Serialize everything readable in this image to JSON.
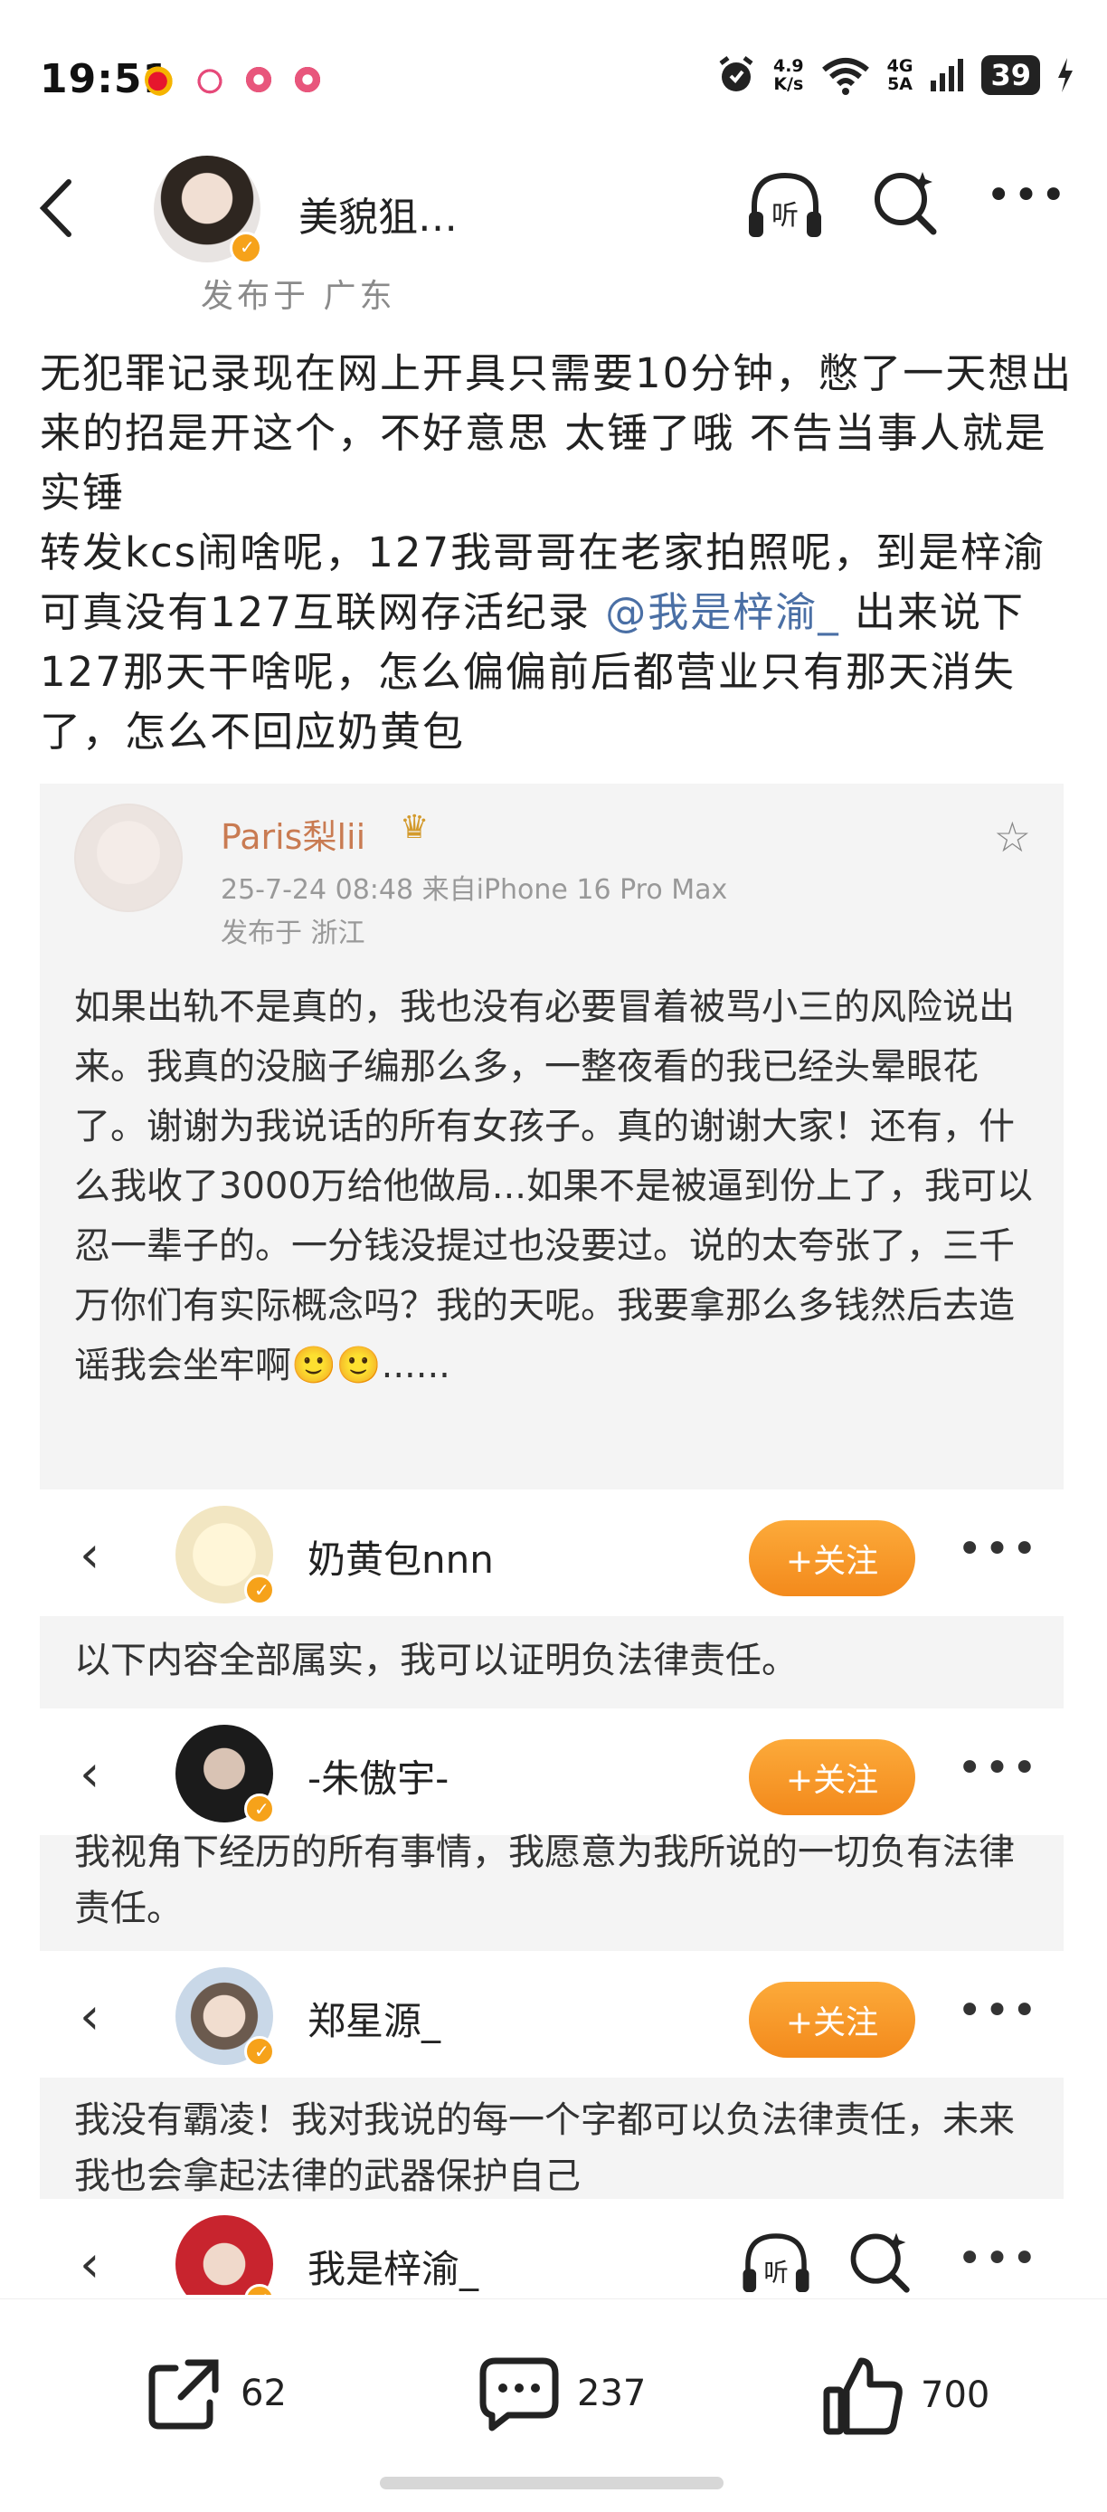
{
  "status_bar": {
    "time": "19:51",
    "net_speed_value": "4.9",
    "net_speed_unit": "K/s",
    "signal_top": "4G",
    "signal_bottom": "5A",
    "battery": "39"
  },
  "header": {
    "username": "美貌狙…",
    "published_location": "发布于 广东"
  },
  "post": {
    "para1": "无犯罪记录现在网上开具只需要10分钟，憋了一天想出来的招是开这个，不好意思 太锤了哦 不告当事人就是实锤",
    "para2_before": "转发kcs闹啥呢，127我哥哥在老家拍照呢，到是梓渝可真没有127互联网存活纪录 ",
    "mention": "@我是梓渝_",
    "para2_after": " 出来说下127那天干啥呢，怎么偏偏前后都营业只有那天消失了，怎么不回应奶黄包"
  },
  "quoted": {
    "name": "Paris梨lii",
    "meta": "25-7-24 08:48  来自iPhone 16 Pro Max",
    "location": "发布于 浙江",
    "body": "如果出轨不是真的，我也没有必要冒着被骂小三的风险说出来。我真的没脑子编那么多，一整夜看的我已经头晕眼花了。谢谢为我说话的所有女孩子。真的谢谢大家！还有，什么我收了3000万给他做局...如果不是被逼到份上了，我可以忍一辈子的。一分钱没提过也没要过。说的太夸张了，三千万你们有实际概念吗？我的天呢。我要拿那么多钱然后去造谣我会坐牢啊🙂🙂......"
  },
  "rows": [
    {
      "name": "奶黄包nnn",
      "follow": "+关注",
      "statement": "以下内容全部属实，我可以证明负法律责任。"
    },
    {
      "name": "-朱傲宇-",
      "follow": "+关注",
      "statement": "我视角下经历的所有事情，我愿意为我所说的一切负有法律责任。"
    },
    {
      "name": "郑星源_",
      "follow": "+关注",
      "statement": "我没有霸凌！我对我说的每一个字都可以负法律责任，未来我也会拿起法律的武器保护自己"
    },
    {
      "name": "我是梓渝_"
    }
  ],
  "actions": {
    "share_count": "62",
    "comment_count": "237",
    "like_count": "700"
  },
  "colors": {
    "follow_orange": "#f59a24",
    "mention_blue": "#4a6fa5",
    "verified_badge": "#f6a21a"
  }
}
